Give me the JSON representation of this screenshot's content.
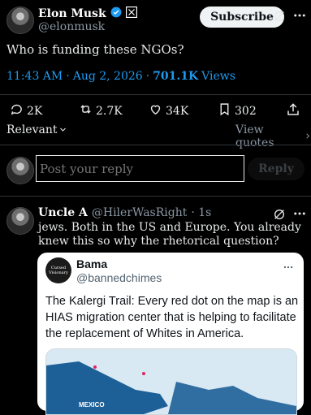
{
  "tweet": {
    "author_name": "Elon Musk",
    "handle": "@elonmusk",
    "subscribe_label": "Subscribe",
    "text": "Who is funding these NGOs?",
    "time": "11:43 AM",
    "date_sep": "·",
    "date": "Aug 2, 2026",
    "dot": "·",
    "views_count": "701.1K",
    "views_label": "Views"
  },
  "actions": {
    "replies": "2K",
    "retweets": "2.7K",
    "likes": "34K",
    "bookmarks": "302"
  },
  "sort": {
    "relevant_label": "Relevant",
    "view_quotes_label": "View quotes"
  },
  "composer": {
    "placeholder": "Post your reply",
    "reply_label": "Reply"
  },
  "reply": {
    "author_name": "Uncle A",
    "handle": "@HilerWasRight",
    "age": "· 1s",
    "text": "jews. Both in the US and Europe. You already knew this so why the rhetorical question?",
    "quoted": {
      "avatar_text": "Cursed Visionary",
      "name": "Bama",
      "handle": "@bannedchimes",
      "text": "The Kalergi Trail: Every red dot on the map is an HIAS migration center that is helping to facilitate the replacement of Whites in America.",
      "map_label": "MEXICO"
    }
  },
  "colors": {
    "accent": "#1d9bf0",
    "verified": "#1d9bf0"
  }
}
